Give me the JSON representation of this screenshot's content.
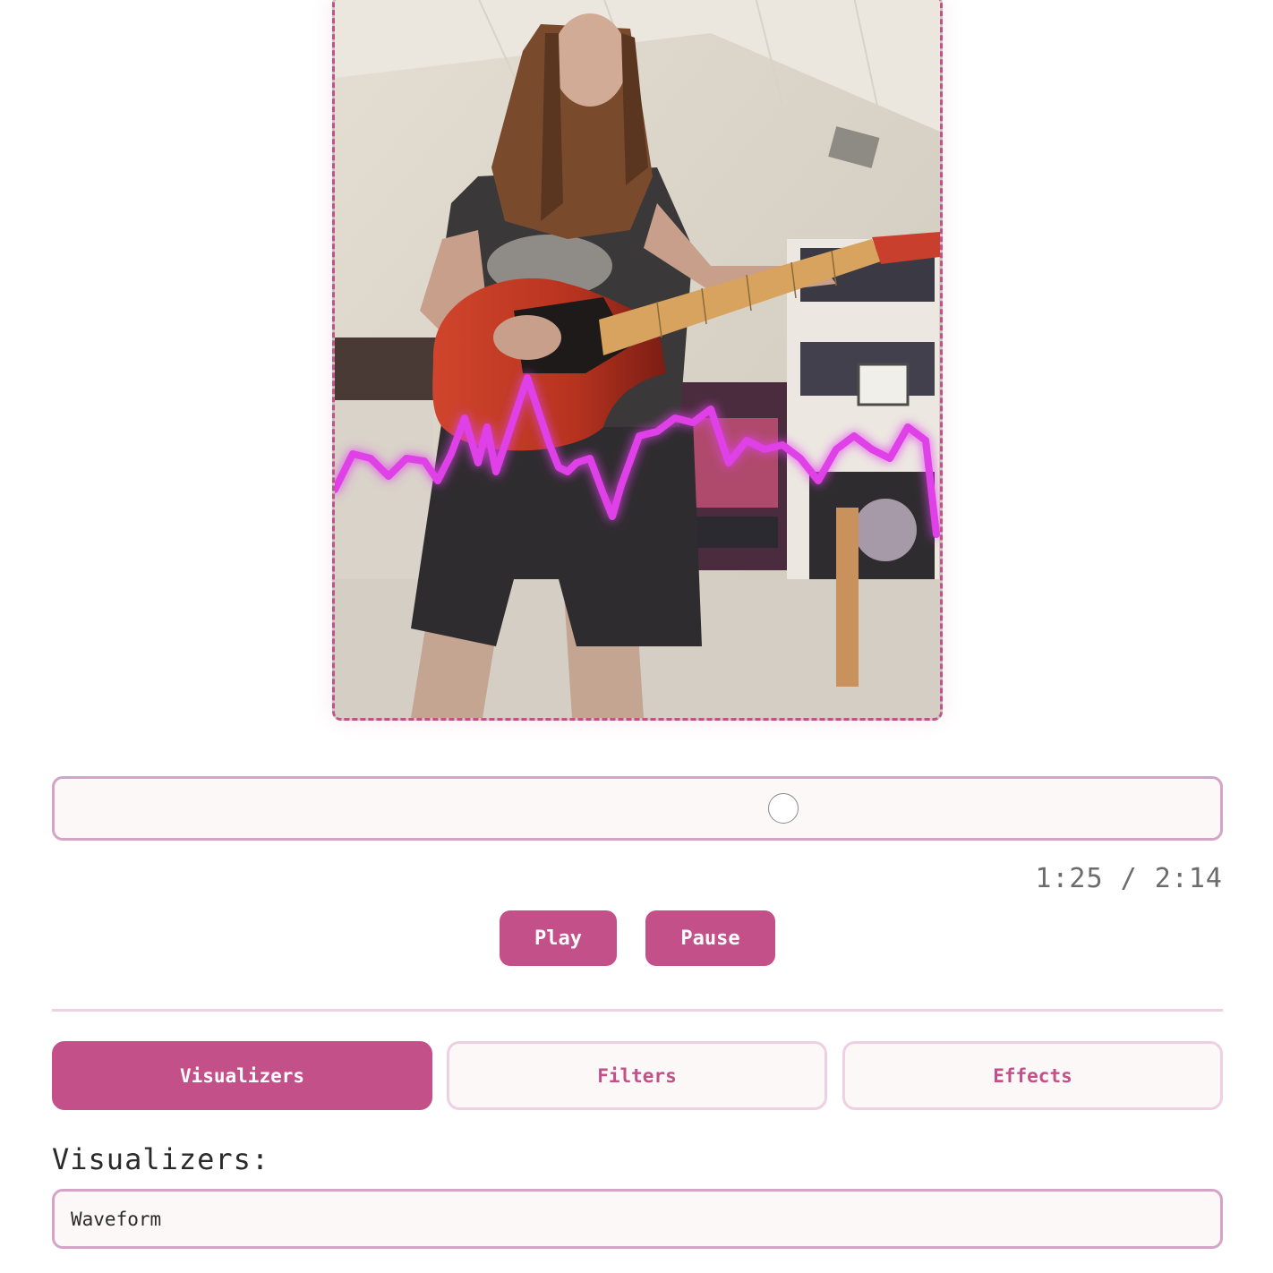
{
  "player": {
    "video_description": "Guitarist with long hair playing a red electric guitar with a waveform overlay",
    "progress_fraction": 0.625,
    "time_current": "1:25",
    "time_total": "2:14",
    "time_display": "1:25 / 2:14",
    "waveform_color": "#e040e8"
  },
  "controls": {
    "play_label": "Play",
    "pause_label": "Pause"
  },
  "tabs": [
    {
      "label": "Visualizers",
      "active": true
    },
    {
      "label": "Filters",
      "active": false
    },
    {
      "label": "Effects",
      "active": false
    }
  ],
  "panel": {
    "section_label": "Visualizers:",
    "selected_visualizer": "Waveform"
  },
  "theme": {
    "accent": "#c4508a",
    "border": "#d6a2c6",
    "tab_inactive_border": "#efcfe2",
    "background": "#fdf8f8"
  }
}
